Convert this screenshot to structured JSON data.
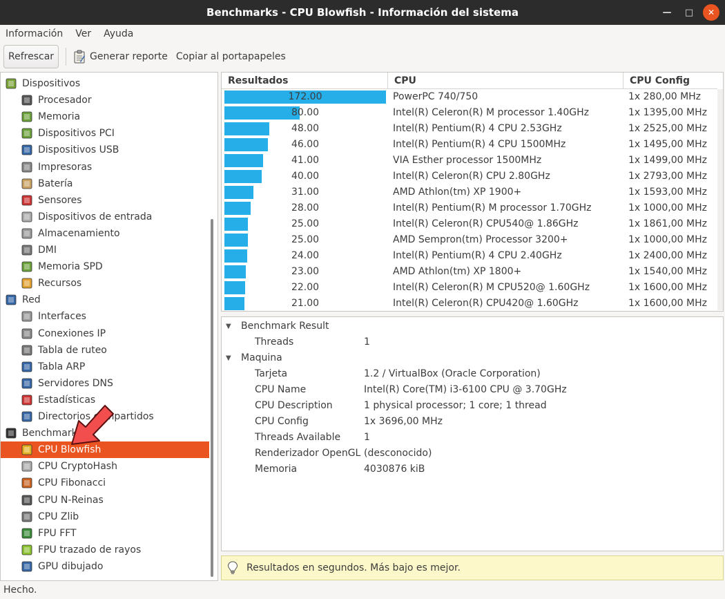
{
  "window": {
    "title": "Benchmarks - CPU Blowfish - Información del sistema"
  },
  "menu": [
    "Información",
    "Ver",
    "Ayuda"
  ],
  "toolbar": {
    "refresh": "Refrescar",
    "report": "Generar reporte",
    "copy": "Copiar al portapapeles"
  },
  "sidebar": {
    "items": [
      {
        "label": "Dispositivos",
        "level": 0,
        "icon": "devices-icon"
      },
      {
        "label": "Procesador",
        "level": 1,
        "icon": "processor-icon"
      },
      {
        "label": "Memoria",
        "level": 1,
        "icon": "memory-icon"
      },
      {
        "label": "Dispositivos PCI",
        "level": 1,
        "icon": "pci-icon"
      },
      {
        "label": "Dispositivos USB",
        "level": 1,
        "icon": "usb-icon"
      },
      {
        "label": "Impresoras",
        "level": 1,
        "icon": "printer-icon"
      },
      {
        "label": "Batería",
        "level": 1,
        "icon": "battery-icon"
      },
      {
        "label": "Sensores",
        "level": 1,
        "icon": "thermometer-icon"
      },
      {
        "label": "Dispositivos de entrada",
        "level": 1,
        "icon": "input-device-icon"
      },
      {
        "label": "Almacenamiento",
        "level": 1,
        "icon": "storage-icon"
      },
      {
        "label": "DMI",
        "level": 1,
        "icon": "computer-icon"
      },
      {
        "label": "Memoria SPD",
        "level": 1,
        "icon": "memory-spd-icon"
      },
      {
        "label": "Recursos",
        "level": 1,
        "icon": "resources-icon"
      },
      {
        "label": "Red",
        "level": 0,
        "icon": "network-icon"
      },
      {
        "label": "Interfaces",
        "level": 1,
        "icon": "interfaces-icon"
      },
      {
        "label": "Conexiones IP",
        "level": 1,
        "icon": "ip-connections-icon"
      },
      {
        "label": "Tabla de ruteo",
        "level": 1,
        "icon": "routing-table-icon"
      },
      {
        "label": "Tabla ARP",
        "level": 1,
        "icon": "arp-table-icon"
      },
      {
        "label": "Servidores DNS",
        "level": 1,
        "icon": "dns-icon"
      },
      {
        "label": "Estadísticas",
        "level": 1,
        "icon": "statistics-icon"
      },
      {
        "label": "Directorios compartidos",
        "level": 1,
        "icon": "shared-folder-icon"
      },
      {
        "label": "Benchmarks",
        "level": 0,
        "icon": "benchmarks-icon"
      },
      {
        "label": "CPU Blowfish",
        "level": 1,
        "icon": "blowfish-icon",
        "selected": true
      },
      {
        "label": "CPU CryptoHash",
        "level": 1,
        "icon": "cryptohash-icon"
      },
      {
        "label": "CPU Fibonacci",
        "level": 1,
        "icon": "fibonacci-icon"
      },
      {
        "label": "CPU N-Reinas",
        "level": 1,
        "icon": "n-queens-icon"
      },
      {
        "label": "CPU Zlib",
        "level": 1,
        "icon": "zlib-icon"
      },
      {
        "label": "FPU FFT",
        "level": 1,
        "icon": "fft-icon"
      },
      {
        "label": "FPU trazado de rayos",
        "level": 1,
        "icon": "raytracing-icon"
      },
      {
        "label": "GPU dibujado",
        "level": 1,
        "icon": "gpu-icon"
      }
    ]
  },
  "results": {
    "headers": [
      "Resultados",
      "CPU",
      "CPU Config"
    ],
    "max": 172.0,
    "rows": [
      {
        "value": 172.0,
        "display": "172.00",
        "cpu": "PowerPC 740/750",
        "config": "1x 280,00 MHz"
      },
      {
        "value": 80.0,
        "display": "80.00",
        "cpu": "Intel(R) Celeron(R) M processor 1.40GHz",
        "config": "1x 1395,00 MHz"
      },
      {
        "value": 48.0,
        "display": "48.00",
        "cpu": "Intel(R) Pentium(R) 4 CPU 2.53GHz",
        "config": "1x 2525,00 MHz"
      },
      {
        "value": 46.0,
        "display": "46.00",
        "cpu": "Intel(R) Pentium(R) 4 CPU 1500MHz",
        "config": "1x 1495,00 MHz"
      },
      {
        "value": 41.0,
        "display": "41.00",
        "cpu": "VIA Esther processor 1500MHz",
        "config": "1x 1499,00 MHz"
      },
      {
        "value": 40.0,
        "display": "40.00",
        "cpu": "Intel(R) Celeron(R) CPU 2.80GHz",
        "config": "1x 2793,00 MHz"
      },
      {
        "value": 31.0,
        "display": "31.00",
        "cpu": "AMD Athlon(tm) XP 1900+",
        "config": "1x 1593,00 MHz"
      },
      {
        "value": 28.0,
        "display": "28.00",
        "cpu": "Intel(R) Pentium(R) M processor 1.70GHz",
        "config": "1x 1000,00 MHz"
      },
      {
        "value": 25.0,
        "display": "25.00",
        "cpu": "Intel(R) Celeron(R) CPU540@ 1.86GHz",
        "config": "1x 1861,00 MHz"
      },
      {
        "value": 25.0,
        "display": "25.00",
        "cpu": "AMD Sempron(tm) Processor 3200+",
        "config": "1x 1000,00 MHz"
      },
      {
        "value": 24.0,
        "display": "24.00",
        "cpu": "Intel(R) Pentium(R) 4 CPU 2.40GHz",
        "config": "1x 2400,00 MHz"
      },
      {
        "value": 23.0,
        "display": "23.00",
        "cpu": "AMD Athlon(tm) XP 1800+",
        "config": "1x 1540,00 MHz"
      },
      {
        "value": 22.0,
        "display": "22.00",
        "cpu": "Intel(R) Celeron(R) M CPU520@ 1.60GHz",
        "config": "1x 1600,00 MHz"
      },
      {
        "value": 21.0,
        "display": "21.00",
        "cpu": "Intel(R) Celeron(R) CPU420@ 1.60GHz",
        "config": "1x 1600,00 MHz"
      }
    ]
  },
  "details": {
    "rows": [
      {
        "type": "section",
        "label": "Benchmark Result"
      },
      {
        "type": "kv",
        "key": "Threads",
        "value": "1"
      },
      {
        "type": "section",
        "label": "Maquina"
      },
      {
        "type": "kv",
        "key": "Tarjeta",
        "value": "1.2 / VirtualBox (Oracle Corporation)"
      },
      {
        "type": "kv",
        "key": "CPU Name",
        "value": "Intel(R) Core(TM) i3-6100 CPU @ 3.70GHz"
      },
      {
        "type": "kv",
        "key": "CPU Description",
        "value": "1 physical processor; 1 core; 1 thread"
      },
      {
        "type": "kv",
        "key": "CPU Config",
        "value": "1x 3696,00 MHz"
      },
      {
        "type": "kv",
        "key": "Threads Available",
        "value": "1"
      },
      {
        "type": "kv",
        "key": "Renderizador OpenGL",
        "value": "(desconocido)"
      },
      {
        "type": "kv",
        "key": "Memoria",
        "value": "4030876 kiB"
      }
    ]
  },
  "info": "Resultados en segundos. Más bajo es mejor.",
  "status": "Hecho.",
  "colors": {
    "accent": "#e95420",
    "bar": "#25aee8",
    "arrow": "#f24e4e"
  }
}
